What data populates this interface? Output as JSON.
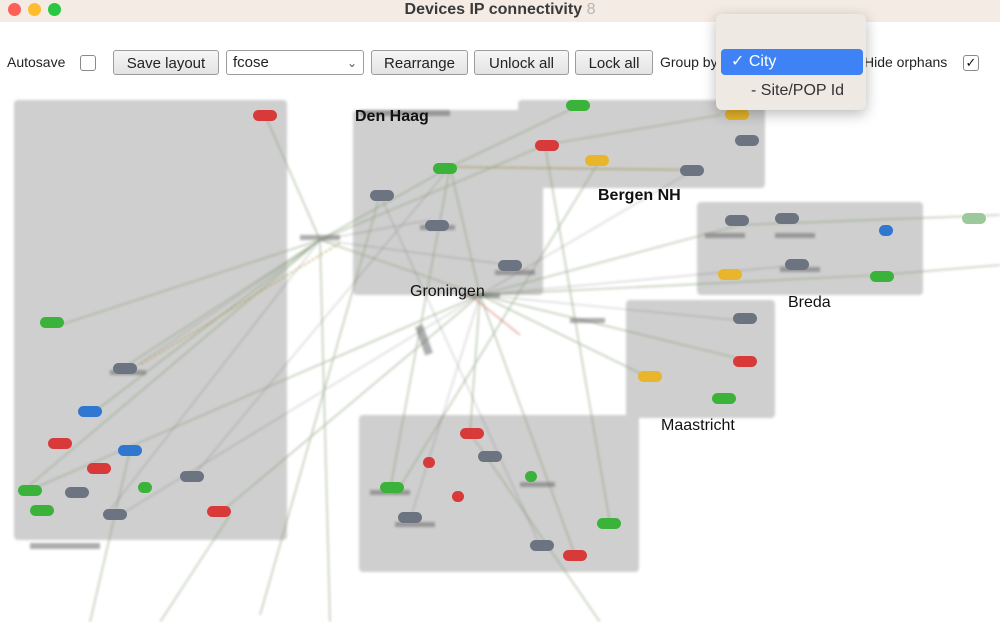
{
  "window": {
    "title": "Devices IP connectivity",
    "title_suffix": "8"
  },
  "toolbar": {
    "autosave_label": "Autosave",
    "autosave_checked": false,
    "save_layout": "Save layout",
    "layout_select_value": "fcose",
    "rearrange": "Rearrange",
    "unlock_all": "Unlock all",
    "lock_all": "Lock all",
    "group_by_label": "Group by",
    "group_by_value": "City",
    "group_by_options": [
      "City",
      "- Site/POP Id"
    ],
    "hide_orphans_label": "Hide orphans",
    "hide_orphans_checked": true
  },
  "dropdown": {
    "selected": "✓ City",
    "option": "- Site/POP Id"
  },
  "cities": {
    "den_haag": "Den Haag",
    "bergen": "Bergen NH",
    "groningen": "Groningen",
    "breda": "Breda",
    "maastricht": "Maastricht"
  },
  "colors": {
    "node_red": "#d83a3a",
    "node_green": "#3bb33b",
    "node_blue": "#2f77cf",
    "node_yellow": "#e9b52b",
    "node_gray": "#6b7480",
    "group_fill": "#cfcfcf",
    "accent": "#3f82f5"
  }
}
